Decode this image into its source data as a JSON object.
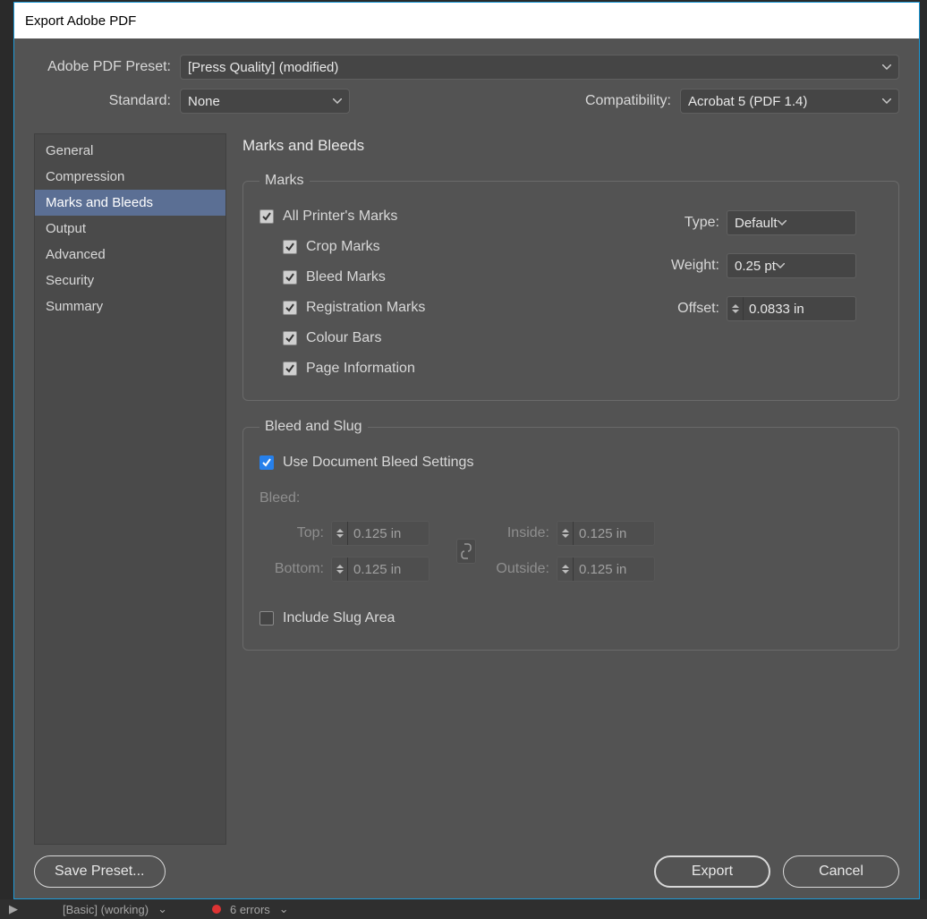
{
  "dialog": {
    "title": "Export Adobe PDF"
  },
  "header": {
    "preset_label": "Adobe PDF Preset:",
    "preset_value": "[Press Quality] (modified)",
    "standard_label": "Standard:",
    "standard_value": "None",
    "compat_label": "Compatibility:",
    "compat_value": "Acrobat 5 (PDF 1.4)"
  },
  "sidebar": {
    "items": [
      {
        "label": "General"
      },
      {
        "label": "Compression"
      },
      {
        "label": "Marks and Bleeds"
      },
      {
        "label": "Output"
      },
      {
        "label": "Advanced"
      },
      {
        "label": "Security"
      },
      {
        "label": "Summary"
      }
    ],
    "selected_index": 2
  },
  "panel": {
    "title": "Marks and Bleeds",
    "marks": {
      "legend": "Marks",
      "all_printers_marks": {
        "label": "All Printer's Marks",
        "checked": true
      },
      "crop_marks": {
        "label": "Crop Marks",
        "checked": true
      },
      "bleed_marks": {
        "label": "Bleed Marks",
        "checked": true
      },
      "registration_marks": {
        "label": "Registration Marks",
        "checked": true
      },
      "colour_bars": {
        "label": "Colour Bars",
        "checked": true
      },
      "page_information": {
        "label": "Page Information",
        "checked": true
      },
      "type_label": "Type:",
      "type_value": "Default",
      "weight_label": "Weight:",
      "weight_value": "0.25 pt",
      "offset_label": "Offset:",
      "offset_value": "0.0833 in"
    },
    "bleed": {
      "legend": "Bleed and Slug",
      "use_doc_label": "Use Document Bleed Settings",
      "use_doc_checked": true,
      "bleed_label": "Bleed:",
      "top_label": "Top:",
      "top_value": "0.125 in",
      "bottom_label": "Bottom:",
      "bottom_value": "0.125 in",
      "inside_label": "Inside:",
      "inside_value": "0.125 in",
      "outside_label": "Outside:",
      "outside_value": "0.125 in",
      "include_slug_label": "Include Slug Area",
      "include_slug_checked": false
    }
  },
  "footer": {
    "save_preset": "Save Preset...",
    "export": "Export",
    "cancel": "Cancel"
  },
  "statusbar": {
    "doc": "[Basic] (working)",
    "errors": "6 errors"
  }
}
